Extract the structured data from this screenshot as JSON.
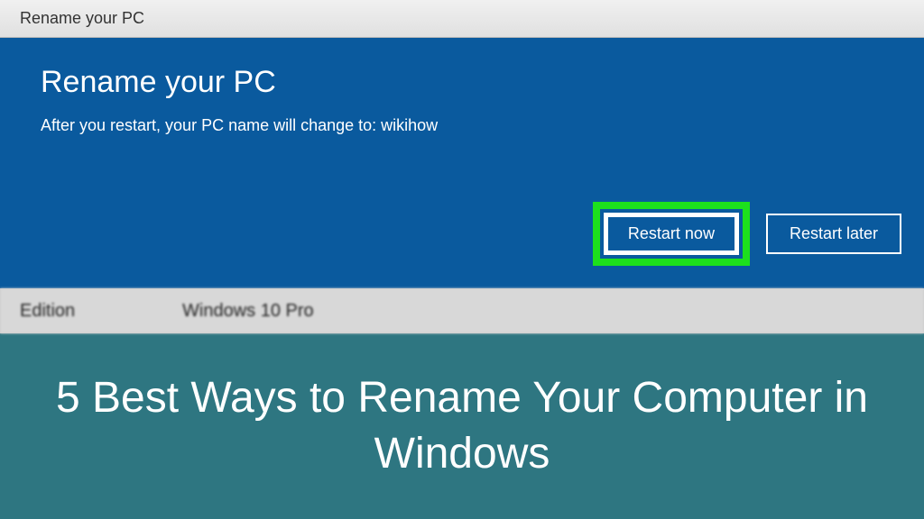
{
  "titlebar": {
    "text": "Rename your PC"
  },
  "dialog": {
    "title": "Rename your PC",
    "message": "After you restart, your PC name will change to: wikihow",
    "restart_now_label": "Restart now",
    "restart_later_label": "Restart later"
  },
  "system_info": {
    "edition_label": "Edition",
    "edition_value": "Windows 10 Pro"
  },
  "banner": {
    "headline": "5 Best Ways to Rename Your Computer in Windows"
  }
}
